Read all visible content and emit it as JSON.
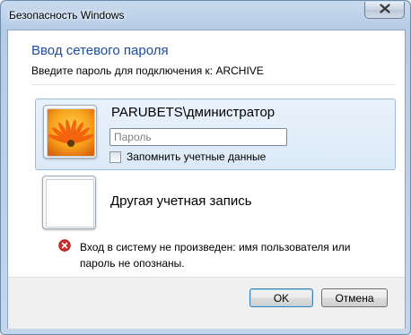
{
  "window": {
    "title": "Безопасность Windows"
  },
  "dialog": {
    "heading": "Ввод сетевого пароля",
    "subheading": "Введите пароль для подключения к: ARCHIVE"
  },
  "credential": {
    "user_name": "PARUBETS\\дминистратор",
    "password_placeholder": "Пароль",
    "password_value": "",
    "remember_label": "Запомнить учетные данные",
    "remember_checked": false
  },
  "other_account": {
    "label": "Другая учетная запись"
  },
  "error": {
    "message": "Вход в систему не произведен: имя пользователя или пароль не опознаны."
  },
  "buttons": {
    "ok_label": "OK",
    "cancel_label": "Отмена"
  },
  "colors": {
    "heading": "#1d4da0",
    "selection_bg": "#dbe9f7",
    "error_red": "#d42b2b"
  },
  "icons": {
    "close": "close-icon",
    "avatar": "flower-avatar-icon",
    "error": "error-icon"
  }
}
